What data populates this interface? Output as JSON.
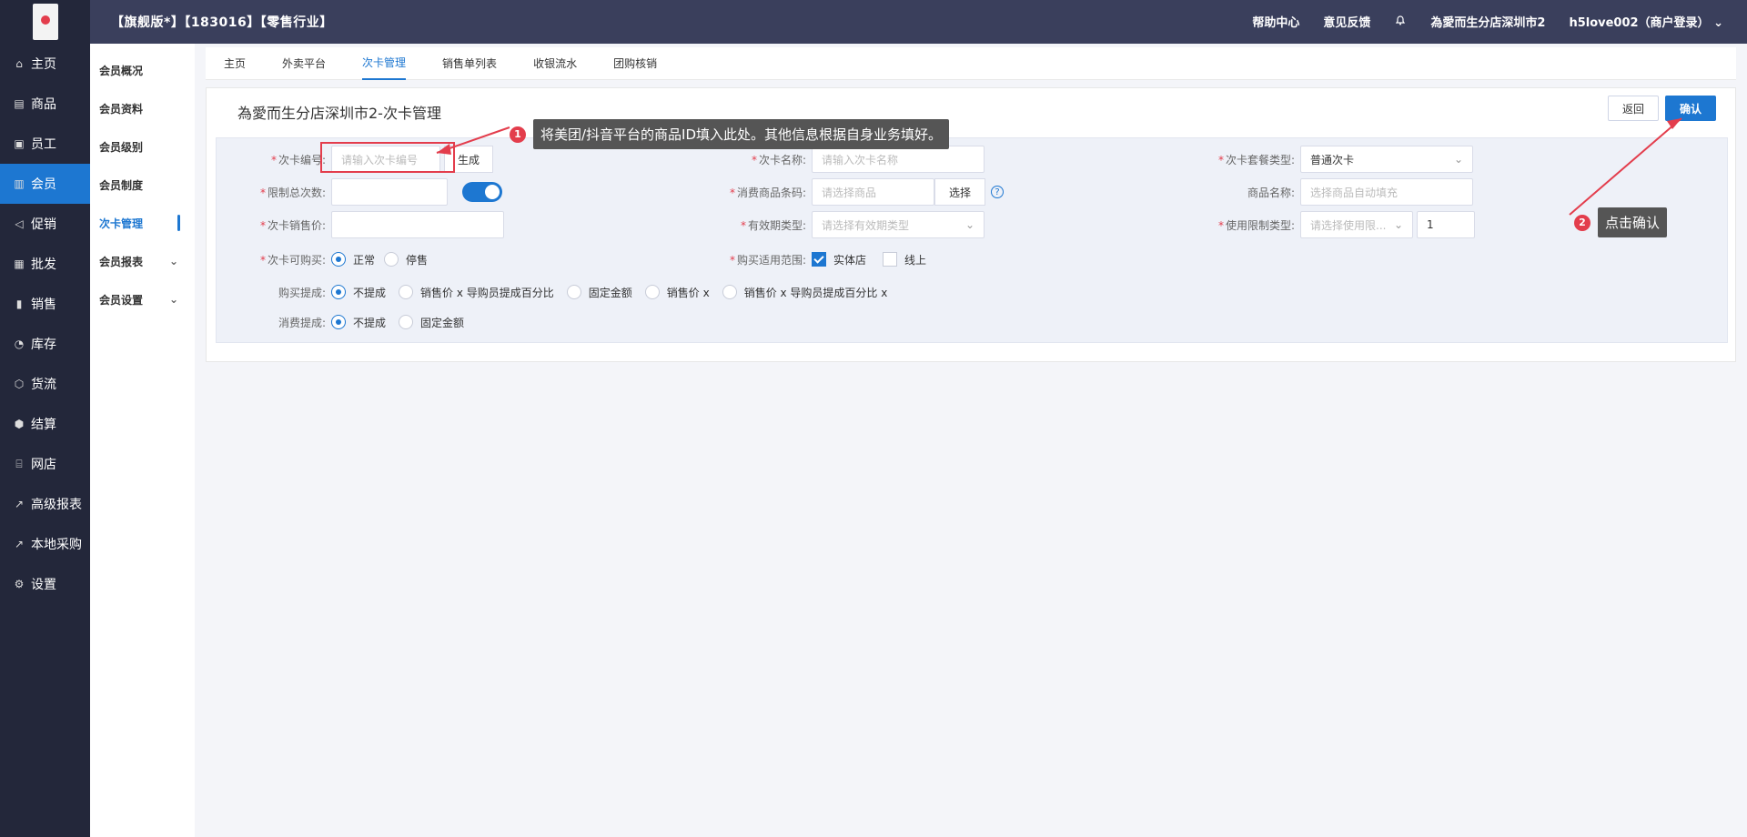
{
  "app": {
    "title": "【旗舰版*】【183016】【零售行业】",
    "topbar": {
      "help": "帮助中心",
      "feedback": "意见反馈",
      "store": "為愛而生分店深圳市2",
      "user": "h5love002（商户登录）"
    }
  },
  "nav": {
    "items": [
      {
        "label": "主页",
        "icon": "home-icon"
      },
      {
        "label": "商品",
        "icon": "goods-icon"
      },
      {
        "label": "员工",
        "icon": "staff-icon"
      },
      {
        "label": "会员",
        "icon": "member-icon",
        "active": true
      },
      {
        "label": "促销",
        "icon": "promotion-icon"
      },
      {
        "label": "批发",
        "icon": "wholesale-icon"
      },
      {
        "label": "销售",
        "icon": "sales-icon"
      },
      {
        "label": "库存",
        "icon": "inventory-icon"
      },
      {
        "label": "货流",
        "icon": "logistics-icon"
      },
      {
        "label": "结算",
        "icon": "settlement-icon"
      },
      {
        "label": "网店",
        "icon": "shop-icon"
      },
      {
        "label": "高级报表",
        "icon": "chart-icon"
      },
      {
        "label": "本地采购",
        "icon": "purchase-icon"
      },
      {
        "label": "设置",
        "icon": "settings-icon"
      }
    ]
  },
  "subnav": {
    "items": [
      {
        "label": "会员概况"
      },
      {
        "label": "会员资料"
      },
      {
        "label": "会员级别"
      },
      {
        "label": "会员制度"
      },
      {
        "label": "次卡管理",
        "active": true
      },
      {
        "label": "会员报表",
        "expand": true
      },
      {
        "label": "会员设置",
        "expand": true
      }
    ]
  },
  "tabs": [
    "主页",
    "外卖平台",
    "次卡管理",
    "销售单列表",
    "收银流水",
    "团购核销"
  ],
  "panel": {
    "title": "為愛而生分店深圳市2-次卡管理",
    "return": "返回",
    "confirm": "确认"
  },
  "form": {
    "card_no": {
      "label": "次卡编号:",
      "placeholder": "请输入次卡编号",
      "generate": "生成"
    },
    "card_name": {
      "label": "次卡名称:",
      "placeholder": "请输入次卡名称"
    },
    "package_type": {
      "label": "次卡套餐类型:",
      "value": "普通次卡"
    },
    "limit_times": {
      "label": "限制总次数:"
    },
    "consume_code": {
      "label": "消费商品条码:",
      "placeholder": "请选择商品",
      "select": "选择"
    },
    "goods_name": {
      "label": "商品名称:",
      "placeholder": "选择商品自动填充"
    },
    "sale_price": {
      "label": "次卡销售价:"
    },
    "valid_type": {
      "label": "有效期类型:",
      "placeholder": "请选择有效期类型"
    },
    "use_limit": {
      "label": "使用限制类型:",
      "placeholder": "请选择使用限...",
      "value": "1"
    },
    "buyable": {
      "label": "次卡可购买:",
      "options": [
        "正常",
        "停售"
      ]
    },
    "scope": {
      "label": "购买适用范围:",
      "options": [
        "实体店",
        "线上"
      ]
    },
    "buy_commission": {
      "label": "购买提成:",
      "options": [
        "不提成",
        "销售价 x 导购员提成百分比",
        "固定金额",
        "销售价 x",
        "销售价 x 导购员提成百分比 x"
      ]
    },
    "consume_commission": {
      "label": "消费提成:",
      "options": [
        "不提成",
        "固定金额"
      ]
    }
  },
  "annotations": {
    "tip1": {
      "num": "1",
      "text": "将美团/抖音平台的商品ID填入此处。其他信息根据自身业务填好。"
    },
    "tip2": {
      "num": "2",
      "text": "点击确认"
    }
  },
  "colors": {
    "accent": "#1d77d1",
    "danger": "#e33d4c",
    "topbar": "#3a3f5c",
    "nav": "#23273a"
  }
}
